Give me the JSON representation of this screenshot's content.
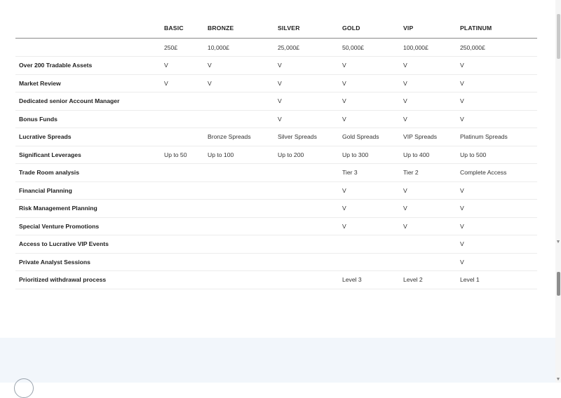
{
  "table": {
    "columns": [
      "",
      "BASIC",
      "BRONZE",
      "SILVER",
      "GOLD",
      "VIP",
      "PLATINUM"
    ],
    "prices": [
      "",
      "250£",
      "10,000£",
      "25,000£",
      "50,000£",
      "100,000£",
      "250,000£"
    ],
    "rows": [
      [
        "Over 200 Tradable Assets",
        "V",
        "V",
        "V",
        "V",
        "V",
        "V"
      ],
      [
        "Market Review",
        "V",
        "V",
        "V",
        "V",
        "V",
        "V"
      ],
      [
        "Dedicated senior Account Manager",
        "",
        "",
        "V",
        "V",
        "V",
        "V"
      ],
      [
        "Bonus Funds",
        "",
        "",
        "V",
        "V",
        "V",
        "V"
      ],
      [
        "Lucrative Spreads",
        "",
        "Bronze Spreads",
        "Silver Spreads",
        "Gold Spreads",
        "VIP Spreads",
        "Platinum Spreads"
      ],
      [
        "Significant Leverages",
        "Up to 50",
        "Up to 100",
        "Up to 200",
        "Up to 300",
        "Up to 400",
        "Up to 500"
      ],
      [
        "Trade Room analysis",
        "",
        "",
        "",
        "Tier 3",
        "Tier 2",
        "Complete Access"
      ],
      [
        "Financial Planning",
        "",
        "",
        "",
        "V",
        "V",
        "V"
      ],
      [
        "Risk Management Planning",
        "",
        "",
        "",
        "V",
        "V",
        "V"
      ],
      [
        "Special Venture Promotions",
        "",
        "",
        "",
        "V",
        "V",
        "V"
      ],
      [
        "Access to Lucrative VIP Events",
        "",
        "",
        "",
        "",
        "",
        "V"
      ],
      [
        "Private Analyst Sessions",
        "",
        "",
        "",
        "",
        "",
        "V"
      ],
      [
        "Prioritized withdrawal process",
        "",
        "",
        "",
        "Level 3",
        "Level 2",
        "Level 1"
      ]
    ]
  },
  "colors": {
    "footer_background": "#f2f6fb",
    "header_rule": "#8a8a8a",
    "row_rule": "#ececec"
  },
  "icons": {
    "scroll_up": "scroll-up-arrow-icon",
    "scroll_down": "scroll-down-arrow-icon"
  }
}
